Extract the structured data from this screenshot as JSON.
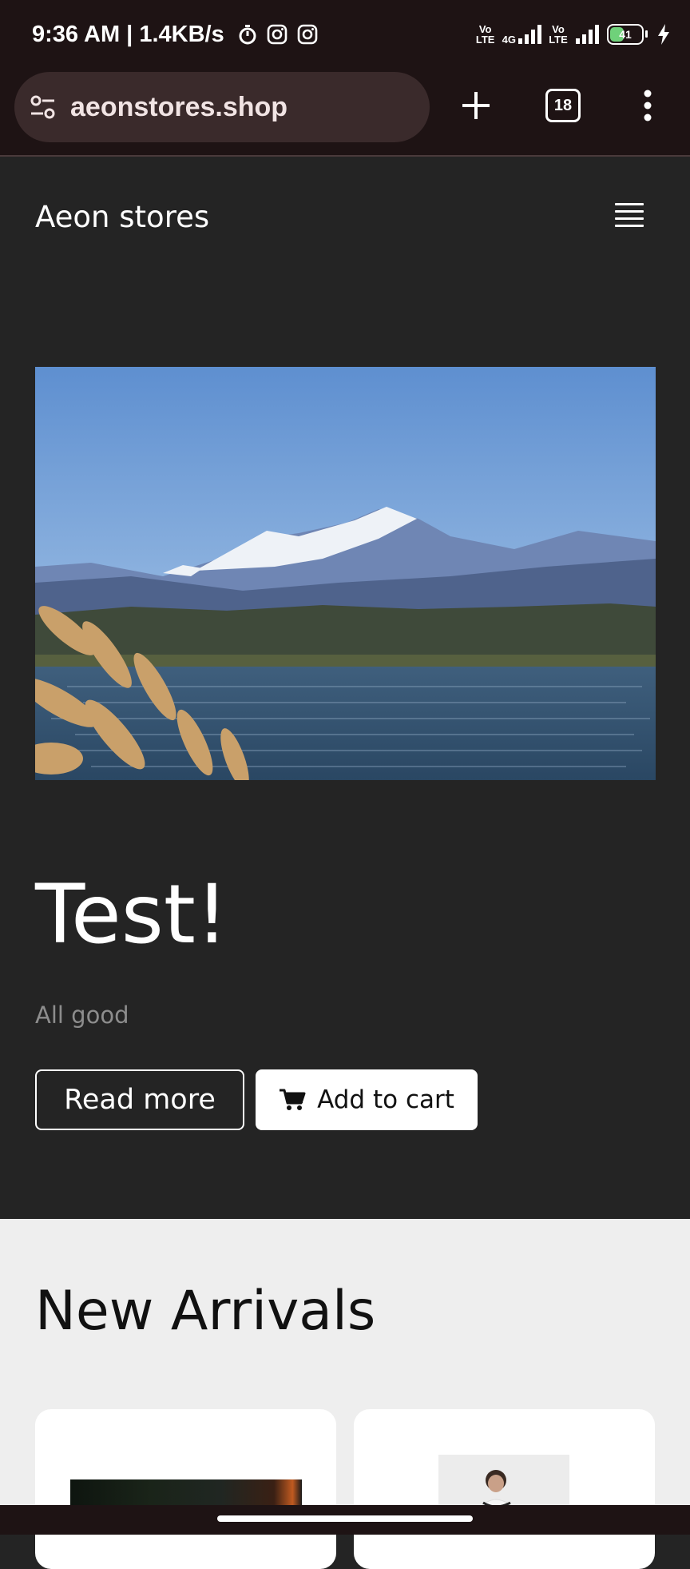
{
  "status_bar": {
    "time_speed": "9:36 AM | 1.4KB/s",
    "battery": "41",
    "volte_1": "Vo LTE",
    "network_1": "4G",
    "volte_2": "Vo LTE"
  },
  "browser": {
    "url": "aeonstores.shop",
    "tab_count": "18"
  },
  "site": {
    "brand": "Aeon stores"
  },
  "hero": {
    "title": "Test!",
    "subtitle": "All good",
    "read_more_label": "Read more",
    "add_to_cart_label": "Add to cart"
  },
  "arrivals": {
    "heading": "New Arrivals"
  },
  "colors": {
    "page_dark": "#242424",
    "browser_chrome": "#1e1314",
    "url_pill": "#3a2a2b",
    "arrivals_bg": "#eeeeee"
  }
}
